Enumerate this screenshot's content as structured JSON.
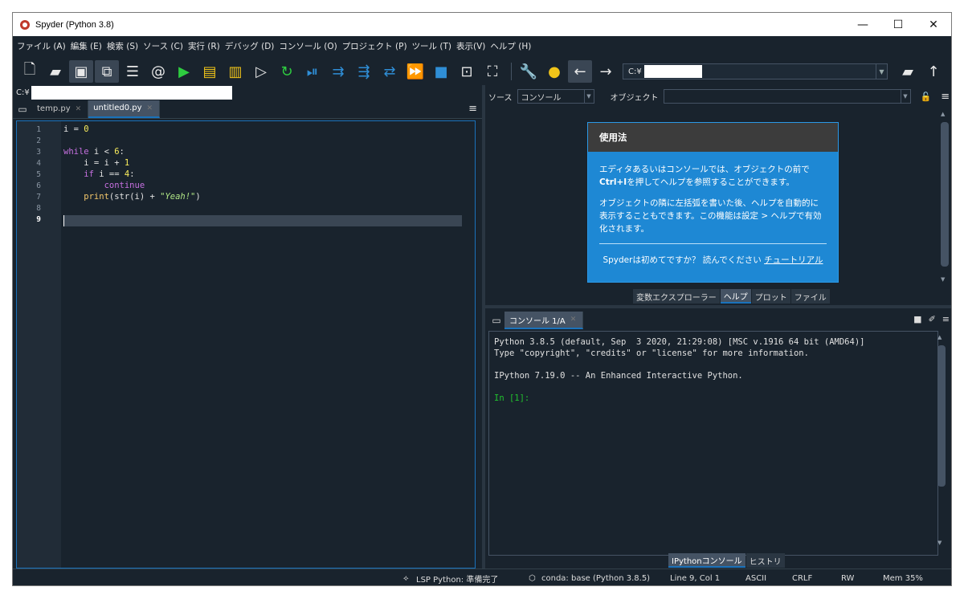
{
  "window": {
    "title": "Spyder (Python 3.8)",
    "controls": [
      "—",
      "☐",
      "✕"
    ]
  },
  "menu": [
    "ファイル (A)",
    "編集 (E)",
    "検索 (S)",
    "ソース (C)",
    "実行 (R)",
    "デバッグ (D)",
    "コンソール (O)",
    "プロジェクト (P)",
    "ツール (T)",
    "表示(V)",
    "ヘルプ (H)"
  ],
  "toolbar": {
    "path_prefix": "C:¥"
  },
  "editor": {
    "path_prefix": "C:¥",
    "tabs": [
      {
        "label": "temp.py",
        "active": false
      },
      {
        "label": "untitled0.py",
        "active": true
      }
    ],
    "line_numbers": [
      "1",
      "2",
      "3",
      "4",
      "5",
      "6",
      "7",
      "8",
      "9"
    ],
    "current_line": "9",
    "code": {
      "l1_var": "i = ",
      "l1_num": "0",
      "l3_kw": "while",
      "l3_mid": " i < ",
      "l3_num": "6",
      "l3_end": ":",
      "l4_a": "    i = i + ",
      "l4_num": "1",
      "l5_kw": "    if",
      "l5_mid": " i == ",
      "l5_num": "4",
      "l5_end": ":",
      "l6_kw": "        continue",
      "l7_fn": "    print",
      "l7_a": "(str(i) + ",
      "l7_str": "\"Yeah!\"",
      "l7_end": ")"
    }
  },
  "help": {
    "source_label": "ソース",
    "source_value": "コンソール",
    "object_label": "オブジェクト",
    "usage_title": "使用法",
    "para1_a": "エディタあるいはコンソールでは、オブジェクトの前で",
    "para1_key": "Ctrl+I",
    "para1_b": "を押してヘルプを参照することができます。",
    "para2": "オブジェクトの隣に左括弧を書いた後、ヘルプを自動的に表示することもできます。この機能は設定 > ヘルプで有効化されます。",
    "foot_a": "Spyderは初めてですか？ 読んでください ",
    "foot_link": "チュートリアル",
    "tabs": [
      "変数エクスプローラー",
      "ヘルプ",
      "プロット",
      "ファイル"
    ],
    "active_tab": "ヘルプ"
  },
  "console": {
    "tab": "コンソール 1/A",
    "lines": [
      "Python 3.8.5 (default, Sep  3 2020, 21:29:08) [MSC v.1916 64 bit (AMD64)]",
      "Type \"copyright\", \"credits\" or \"license\" for more information.",
      "",
      "IPython 7.19.0 -- An Enhanced Interactive Python.",
      ""
    ],
    "prompt": "In [1]:",
    "bottom_tabs": [
      "IPythonコンソール",
      "ヒストリ"
    ],
    "active_bottom_tab": "IPythonコンソール"
  },
  "status": {
    "lsp": "LSP Python: 準備完了",
    "conda": "conda: base (Python 3.8.5)",
    "position": "Line 9, Col 1",
    "encoding": "ASCII",
    "eol": "CRLF",
    "permissions": "RW",
    "memory": "Mem 35%"
  },
  "colors": {
    "background": "#19232d",
    "accent": "#1a72bb",
    "usage_box": "#1e88d4",
    "prompt": "#21c12e"
  }
}
